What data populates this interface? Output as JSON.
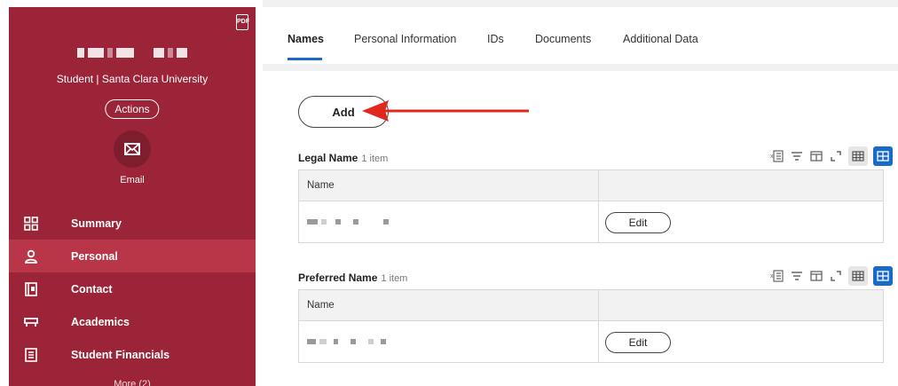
{
  "sidebar": {
    "subtitle": "Student | Santa Clara University",
    "actions_label": "Actions",
    "email_label": "Email",
    "nav": [
      {
        "label": "Summary",
        "icon": "summary-grid-icon",
        "active": false
      },
      {
        "label": "Personal",
        "icon": "person-icon",
        "active": true
      },
      {
        "label": "Contact",
        "icon": "contact-card-icon",
        "active": false
      },
      {
        "label": "Academics",
        "icon": "graduation-cap-icon",
        "active": false
      },
      {
        "label": "Student Financials",
        "icon": "ledger-icon",
        "active": false
      }
    ],
    "more_label": "More (2)"
  },
  "tabs": [
    {
      "label": "Names",
      "active": true
    },
    {
      "label": "Personal Information",
      "active": false
    },
    {
      "label": "IDs",
      "active": false
    },
    {
      "label": "Documents",
      "active": false
    },
    {
      "label": "Additional Data",
      "active": false
    }
  ],
  "add_label": "Add",
  "sections": [
    {
      "title": "Legal Name",
      "count": "1 item",
      "column": "Name",
      "edit_label": "Edit"
    },
    {
      "title": "Preferred Name",
      "count": "1 item",
      "column": "Name",
      "edit_label": "Edit"
    }
  ],
  "colors": {
    "brand": "#9b2438",
    "active_nav": "#b93548",
    "accent_blue": "#1a6bc9",
    "arrow_red": "#e0281f"
  }
}
